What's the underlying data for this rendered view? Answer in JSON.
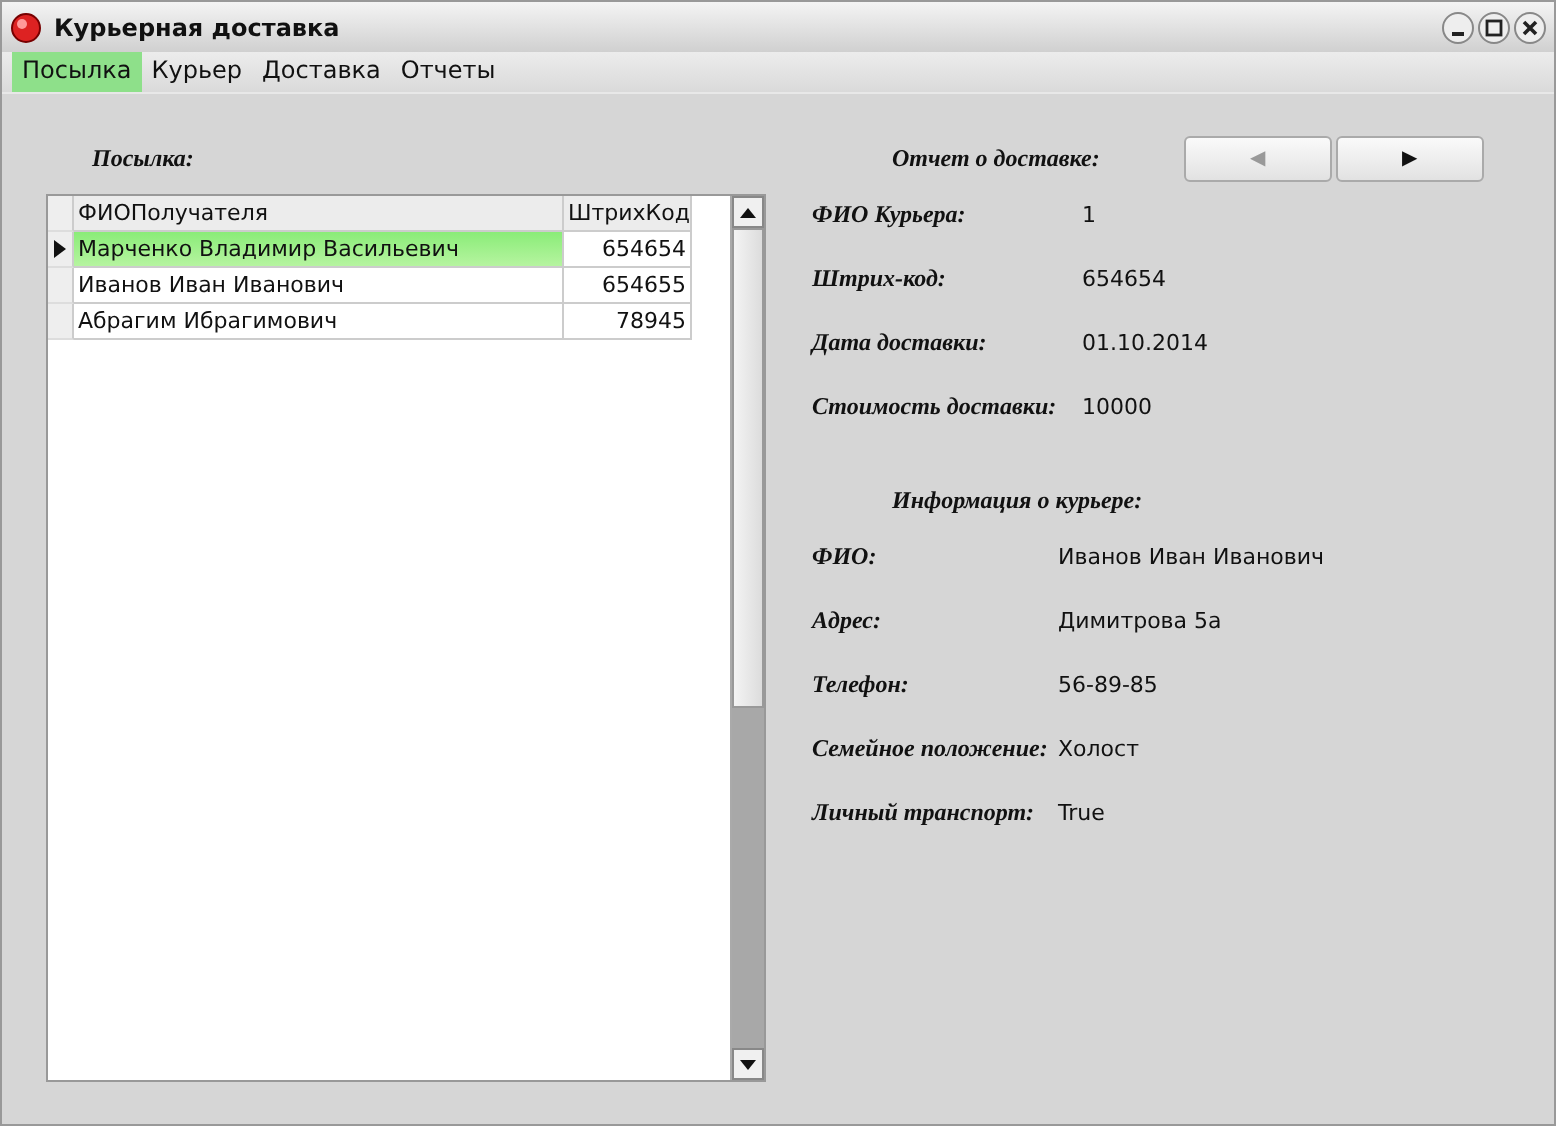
{
  "window": {
    "title": "Курьерная доставка"
  },
  "menu": [
    {
      "label": "Посылка",
      "selected": true
    },
    {
      "label": "Курьер",
      "selected": false
    },
    {
      "label": "Доставка",
      "selected": false
    },
    {
      "label": "Отчеты",
      "selected": false
    }
  ],
  "parcel_panel": {
    "heading": "Посылка:",
    "table": {
      "columns": [
        "ФИОПолучателя",
        "ШтрихКод"
      ],
      "rows": [
        {
          "cells": [
            "Марченко Владимир Васильевич",
            "654654"
          ],
          "selected": true
        },
        {
          "cells": [
            "Иванов Иван Иванович",
            "654655"
          ],
          "selected": false
        },
        {
          "cells": [
            "Абрагим Ибрагимович",
            "78945"
          ],
          "selected": false
        }
      ]
    }
  },
  "report": {
    "heading": "Отчет о доставке:",
    "nav_buttons": [
      {
        "glyph": "◀",
        "disabled": true
      },
      {
        "glyph": "▶",
        "disabled": false
      }
    ],
    "fields": [
      {
        "label": "ФИО Курьера:",
        "value": "1"
      },
      {
        "label": "Штрих-код:",
        "value": "654654"
      },
      {
        "label": "Дата доставки:",
        "value": "01.10.2014"
      },
      {
        "label": "Стоимость доставки:",
        "value": "10000"
      }
    ]
  },
  "courier_info": {
    "heading": "Информация о курьере:",
    "fields": [
      {
        "label": "ФИО:",
        "value": "Иванов Иван Иванович"
      },
      {
        "label": "Адрес:",
        "value": "Димитрова 5а"
      },
      {
        "label": "Телефон:",
        "value": "56-89-85"
      },
      {
        "label": "Семейное положение:",
        "value": "Холост"
      },
      {
        "label": "Личный транспорт:",
        "value": "True"
      }
    ]
  }
}
